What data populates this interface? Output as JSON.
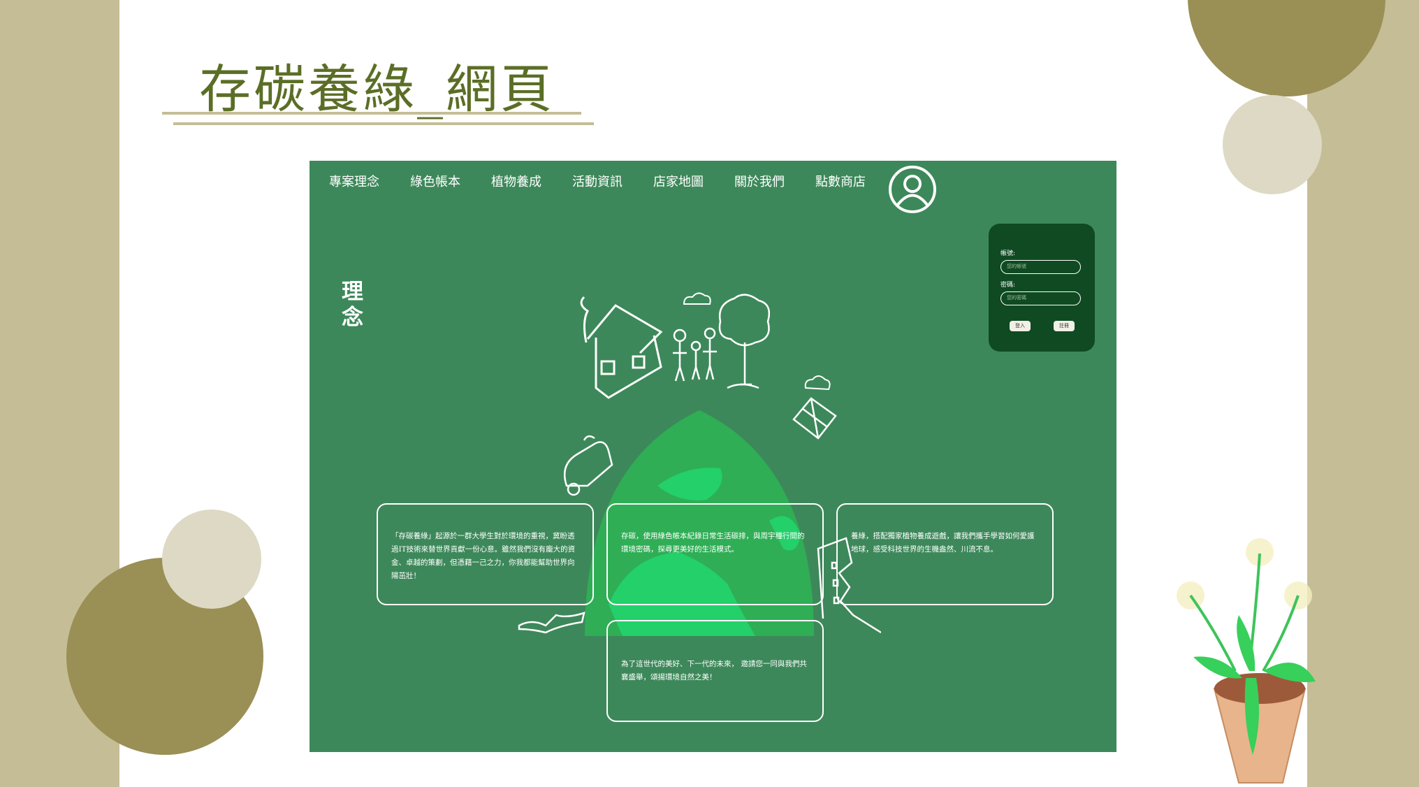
{
  "slide": {
    "title": "存碳養綠_網頁"
  },
  "colors": {
    "side_beige": "#c5bd96",
    "olive": "#9a8f55",
    "cream": "#ddd9c5",
    "title_green": "#5b6e26",
    "page_green": "#3d885a",
    "login_bg": "#0f4a22"
  },
  "nav": {
    "items": [
      {
        "label": "專案理念"
      },
      {
        "label": "綠色帳本"
      },
      {
        "label": "植物養成"
      },
      {
        "label": "活動資訊"
      },
      {
        "label": "店家地圖"
      },
      {
        "label": "關於我們"
      },
      {
        "label": "點數商店"
      }
    ],
    "user_icon": "user-avatar-icon"
  },
  "section": {
    "label": "理念"
  },
  "login": {
    "account_label": "帳號:",
    "account_placeholder": "您的帳號",
    "password_label": "密碼:",
    "password_placeholder": "您的密碼",
    "login_button": "登入",
    "register_button": "註冊"
  },
  "cards": [
    {
      "text": "「存碳養綠」起源於一群大學生對於環境的重視，冀盼透過IT技術來替世界貢獻一份心意。雖然我們沒有龐大的資金、卓越的策劃，但憑藉一己之力，你我都能幫助世界向陽茁壯！"
    },
    {
      "text": "存碳，使用綠色帳本紀錄日常生活碳排，與周宇種行間的環境密碼，探尋更美好的生活模式。"
    },
    {
      "text": "養綠，搭配獨家植物養成遊戲，讓我們攜手學習如何愛護地球，感受科技世界的生機盎然、川流不息。"
    },
    {
      "text": "為了這世代的美好、下一代的未來， 邀請您一同與我們共襄盛舉，頌揚環境自然之美！"
    }
  ]
}
